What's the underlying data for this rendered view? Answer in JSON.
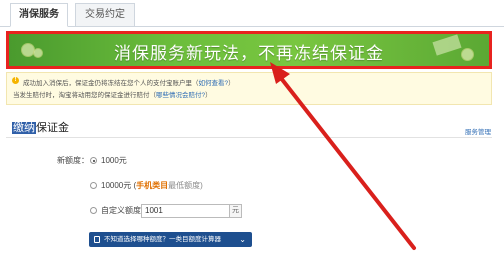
{
  "tabs": [
    {
      "label": "消保服务"
    },
    {
      "label": "交易约定"
    }
  ],
  "banner": {
    "text": "消保服务新玩法，不再冻结保证金"
  },
  "notice": {
    "line1": "成功加入消保后，保证金仍将冻结在您个人的支付宝账户里（",
    "line1_link": "如何查看?",
    "line1_end": "）",
    "line2": "当发生赔付时，淘宝将动用您的保证金进行赔付（",
    "line2_link": "哪些情况会赔付?",
    "line2_end": "）"
  },
  "section": {
    "title_highlight": "缴纳",
    "title_rest": "保证金",
    "manage_link": "服务管理"
  },
  "form": {
    "amount_label": "新额度：",
    "options": [
      {
        "text": "1000元",
        "selected": true
      },
      {
        "text": "10000元 (",
        "category": "手机类目",
        "suffix": "最低额度)",
        "selected": false
      },
      {
        "text": "自定义额度",
        "selected": false
      }
    ],
    "custom_value": "1001",
    "unit": "元"
  },
  "calc_button": {
    "label": "不知道选择哪种额度？一类目额度计算器",
    "chevron": "⌄"
  },
  "colors": {
    "highlight_border": "#e8231f",
    "banner": "#6cbe3c",
    "button": "#1e4f8f",
    "link": "#2f6db5"
  }
}
